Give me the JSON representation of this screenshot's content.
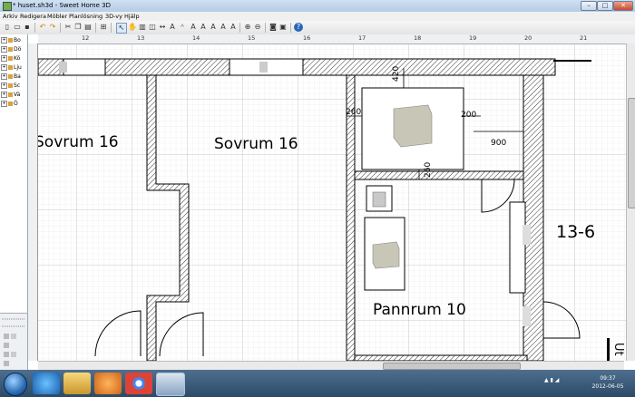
{
  "window": {
    "title": "* huset.sh3d - Sweet Home 3D"
  },
  "window_controls": {
    "minimize": "–",
    "maximize": "□",
    "close": "✕"
  },
  "menu": [
    "Arkiv",
    "Redigera",
    "Möbler",
    "Planlösning",
    "3D-vy",
    "Hjälp"
  ],
  "toolbar_icons": [
    "new-icon",
    "open-icon",
    "save-icon",
    "undo-icon",
    "redo-icon",
    "cut-icon",
    "copy-icon",
    "paste-icon",
    "add-furniture-icon",
    "select-icon",
    "pan-icon",
    "create-walls-icon",
    "create-rooms-icon",
    "create-dimensions-icon",
    "create-labels-icon",
    "text-style-icon",
    "zoom-in-icon",
    "zoom-out-icon",
    "photo-icon",
    "video-icon",
    "help-icon"
  ],
  "tree": [
    "Bo",
    "Dö",
    "Kö",
    "Lju",
    "Ba",
    "Sc",
    "Vä",
    "Ö"
  ],
  "ruler": {
    "h_labels": [
      "12",
      "13",
      "14",
      "15",
      "16",
      "17",
      "18",
      "19",
      "20",
      "21"
    ]
  },
  "rooms": [
    {
      "name": "Sovrum 16",
      "id": "r1"
    },
    {
      "name": "Sovrum 16",
      "id": "r2"
    },
    {
      "name": "Pannrum 10",
      "id": "r3"
    },
    {
      "name": "13-6",
      "id": "r4"
    }
  ],
  "dimensions": {
    "d420": "420",
    "d260a": "260",
    "d200": "200",
    "d900": "900",
    "d260b": "260"
  },
  "edge_label": "Ut",
  "taskbar": {
    "apps": [
      "ie-icon",
      "explorer-icon",
      "media-player-icon",
      "chrome-icon",
      "sweet-home-3d-icon"
    ]
  },
  "clock": {
    "time": "09:37",
    "date": "2012-06-05"
  }
}
